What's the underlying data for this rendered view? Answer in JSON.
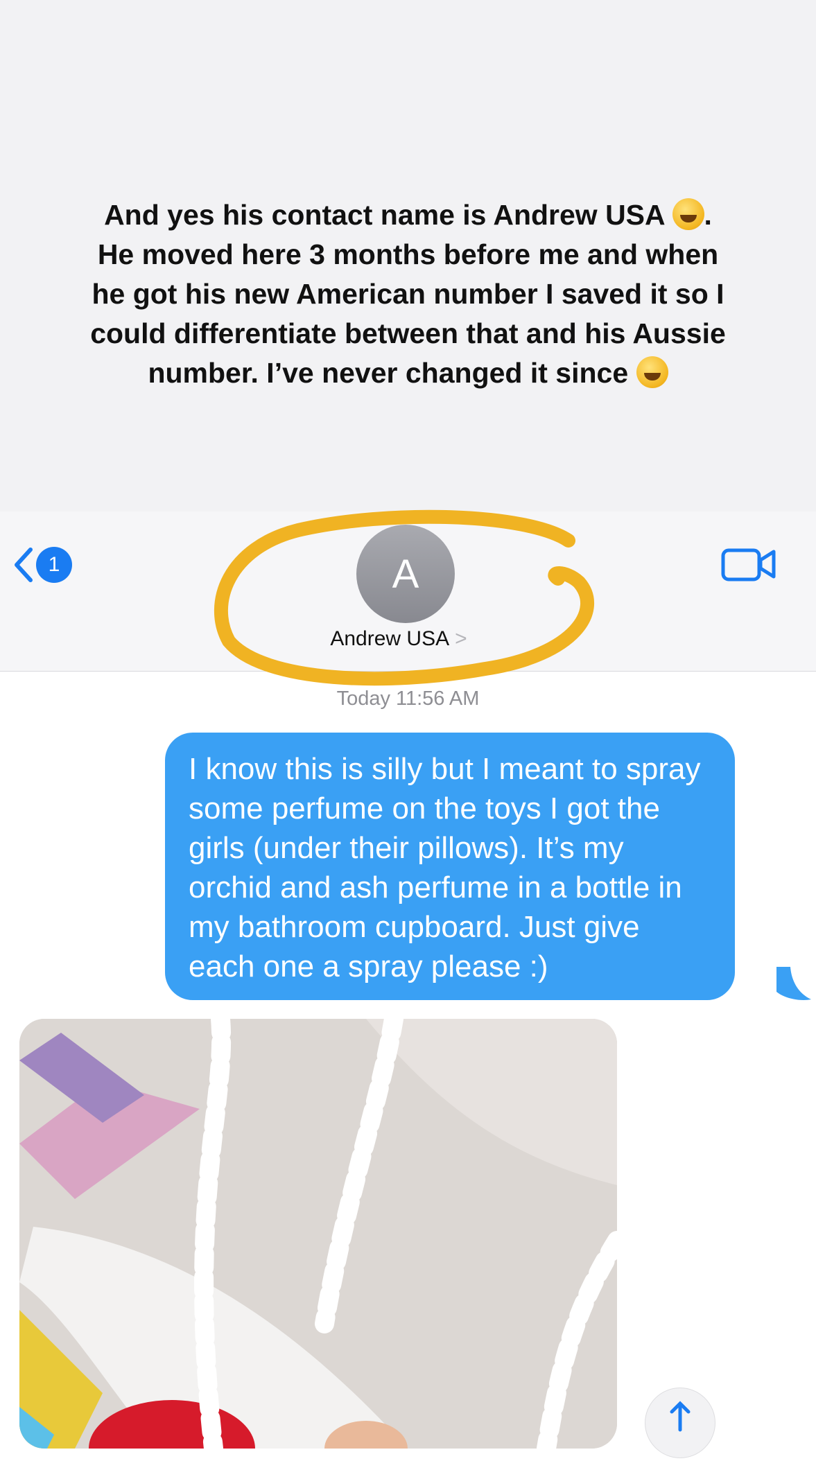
{
  "caption": {
    "text_part1": "And yes his contact name is Andrew USA",
    "text_part2": ". He moved here 3 months before me and when he got his new American number I saved it so I could differentiate between that and his Aussie number. I’ve never changed it since",
    "emoji1": "rolling-on-floor-laughing-emoji",
    "emoji2": "grinning-sweat-emoji"
  },
  "nav": {
    "back_badge": "1",
    "avatar_initial": "A",
    "contact_name": "Andrew USA",
    "name_chevron": ">",
    "video_icon": "video-camera-icon"
  },
  "thread": {
    "timestamp": "Today 11:56 AM",
    "message": "I know this is silly but I meant to spray some perfume on the toys I got the girls (under their pillows). It’s my orchid and ash perfume in a bottle in my bathroom cupboard. Just give each one a spray please :)"
  },
  "colors": {
    "bubble": "#3aa0f4",
    "badge": "#1a7cf2",
    "highlight": "#f0b323",
    "caption_bg": "#f2f2f4"
  }
}
